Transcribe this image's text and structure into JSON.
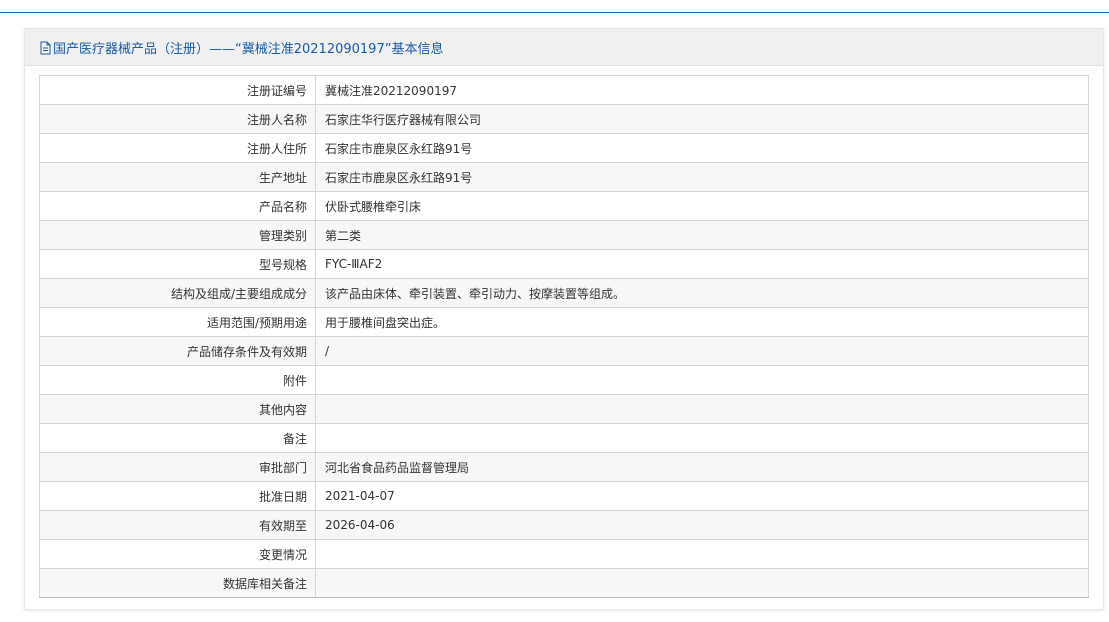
{
  "header": {
    "title": "国产医疗器械产品（注册）——“冀械注准20212090197”基本信息",
    "icon": "document-icon"
  },
  "colors": {
    "title": "#1a5aa6",
    "top_rule": "#1f5fa8",
    "border": "#d6d6d6"
  },
  "rows": [
    {
      "label": "注册证编号",
      "value": "冀械注准20212090197"
    },
    {
      "label": "注册人名称",
      "value": "石家庄华行医疗器械有限公司"
    },
    {
      "label": "注册人住所",
      "value": "石家庄市鹿泉区永红路91号"
    },
    {
      "label": "生产地址",
      "value": "石家庄市鹿泉区永红路91号"
    },
    {
      "label": "产品名称",
      "value": "伏卧式腰椎牵引床"
    },
    {
      "label": "管理类别",
      "value": "第二类"
    },
    {
      "label": "型号规格",
      "value": "FYC-ⅢAF2"
    },
    {
      "label": "结构及组成/主要组成成分",
      "value": "该产品由床体、牵引装置、牵引动力、按摩装置等组成。"
    },
    {
      "label": "适用范围/预期用途",
      "value": "用于腰椎间盘突出症。"
    },
    {
      "label": "产品储存条件及有效期",
      "value": "/"
    },
    {
      "label": "附件",
      "value": ""
    },
    {
      "label": "其他内容",
      "value": ""
    },
    {
      "label": "备注",
      "value": ""
    },
    {
      "label": "审批部门",
      "value": "河北省食品药品监督管理局"
    },
    {
      "label": "批准日期",
      "value": "2021-04-07"
    },
    {
      "label": "有效期至",
      "value": "2026-04-06"
    },
    {
      "label": "变更情况",
      "value": ""
    },
    {
      "label": "数据库相关备注",
      "value": ""
    }
  ]
}
